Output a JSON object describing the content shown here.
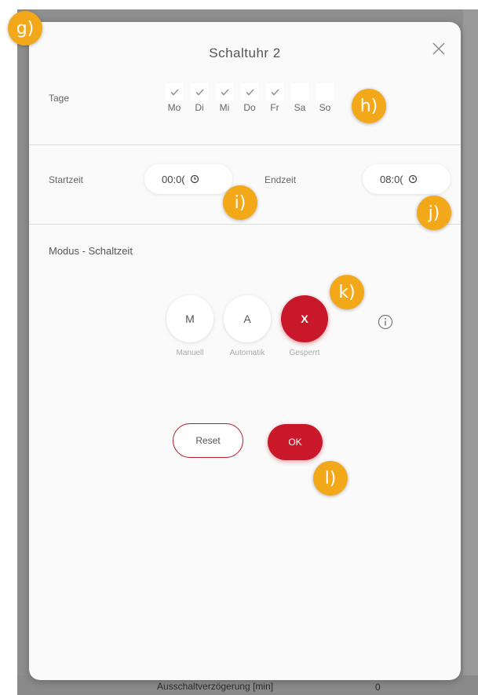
{
  "background": {
    "row_label": "Ausschaltverzögerung [min]",
    "row_value": "0"
  },
  "modal": {
    "title": "Schaltuhr 2",
    "close_icon": "close-icon",
    "days": {
      "label": "Tage",
      "items": [
        {
          "label": "Mo",
          "checked": true
        },
        {
          "label": "Di",
          "checked": true
        },
        {
          "label": "Mi",
          "checked": true
        },
        {
          "label": "Do",
          "checked": true
        },
        {
          "label": "Fr",
          "checked": true
        },
        {
          "label": "Sa",
          "checked": false
        },
        {
          "label": "So",
          "checked": false
        }
      ]
    },
    "start": {
      "label": "Startzeit",
      "value": "00:0("
    },
    "end": {
      "label": "Endzeit",
      "value": "08:0("
    },
    "mode": {
      "label": "Modus - Schaltzeit",
      "options": [
        {
          "letter": "M",
          "label": "Manuell",
          "active": false
        },
        {
          "letter": "A",
          "label": "Automatik",
          "active": false
        },
        {
          "letter": "X",
          "label": "Gesperrt",
          "active": true
        }
      ]
    },
    "reset_label": "Reset",
    "ok_label": "OK"
  },
  "badges": [
    "g)",
    "h)",
    "i)",
    "j)",
    "k)",
    "l)"
  ],
  "colors": {
    "accent": "#c8182a",
    "badge": "#f3a81a",
    "backdrop": "#8e8e8e"
  }
}
